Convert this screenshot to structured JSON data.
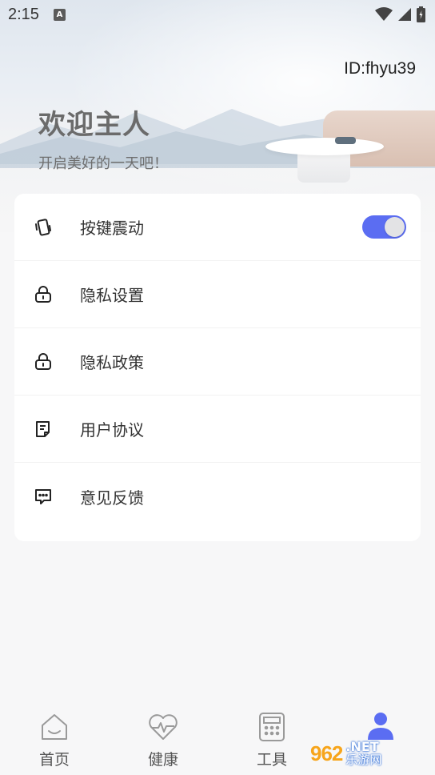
{
  "status_bar": {
    "time": "2:15",
    "notification_badge": "A",
    "icons": [
      "wifi-icon",
      "signal-icon",
      "battery-icon"
    ]
  },
  "header": {
    "user_id": "ID:fhyu39",
    "welcome": "欢迎主人",
    "subtitle": "开启美好的一天吧！"
  },
  "settings": {
    "items": [
      {
        "label": "按键震动",
        "icon": "vibration-icon",
        "has_toggle": true,
        "toggle_on": true
      },
      {
        "label": "隐私设置",
        "icon": "lock-icon"
      },
      {
        "label": "隐私政策",
        "icon": "lock-icon"
      },
      {
        "label": "用户协议",
        "icon": "document-icon"
      },
      {
        "label": "意见反馈",
        "icon": "feedback-icon"
      }
    ]
  },
  "bottom_nav": {
    "items": [
      {
        "label": "首页",
        "icon": "home-icon"
      },
      {
        "label": "健康",
        "icon": "heart-pulse-icon"
      },
      {
        "label": "工具",
        "icon": "calculator-icon"
      },
      {
        "label": "",
        "icon": "profile-icon",
        "active": true
      }
    ]
  },
  "watermark": {
    "number": "962",
    "net": ".NET",
    "site": "乐游网"
  },
  "colors": {
    "accent": "#5b6df2",
    "toggle_knob": "#e3e3e5",
    "background": "#f7f7f8"
  }
}
